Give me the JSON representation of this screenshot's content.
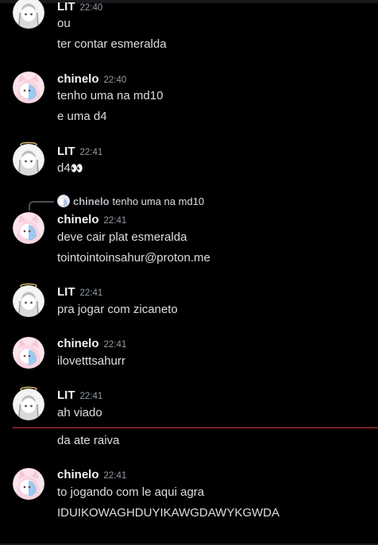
{
  "users": {
    "lit": "LIT",
    "chinelo": "chinelo"
  },
  "messages": {
    "m1": {
      "author": "LIT",
      "time": "22:40",
      "lines": [
        "ou",
        "ter contar esmeralda"
      ]
    },
    "m2": {
      "author": "chinelo",
      "time": "22:40",
      "lines": [
        "tenho uma na md10",
        "e uma d4"
      ]
    },
    "m3": {
      "author": "LIT",
      "time": "22:41",
      "lines": [
        "d4"
      ],
      "emoji": "👀"
    },
    "m4": {
      "reply": {
        "author": "chinelo",
        "text": "tenho uma na md10"
      },
      "author": "chinelo",
      "time": "22:41",
      "lines": [
        "deve cair plat esmeralda",
        "tointointoinsahur@proton.me"
      ]
    },
    "m5": {
      "author": "LIT",
      "time": "22:41",
      "lines": [
        "pra jogar com zicaneto"
      ]
    },
    "m6": {
      "author": "chinelo",
      "time": "22:41",
      "lines": [
        "ilovetttsahurr"
      ]
    },
    "m7": {
      "author": "LIT",
      "time": "22:41",
      "lines": [
        "ah viado",
        "da ate raiva"
      ]
    },
    "m8": {
      "author": "chinelo",
      "time": "22:41",
      "lines": [
        "to jogando com le aqui agra",
        "IDUIKOWAGHDUYIKAWGDAWYKGWDA"
      ]
    }
  },
  "colors": {
    "background": "#000000",
    "username": "#f2f3f5",
    "timestamp": "#949ba4",
    "message_text": "#dbdee1",
    "new_messages_divider": "#c93b3b"
  },
  "icons": {
    "lit_avatar": "anime-girl-avatar-icon",
    "lit_decoration": "halo-icon",
    "chinelo_avatar": "cat-ear-hood-avatar-icon",
    "reply": "reply-spine-icon",
    "emoji": "eyes-emoji-icon"
  }
}
